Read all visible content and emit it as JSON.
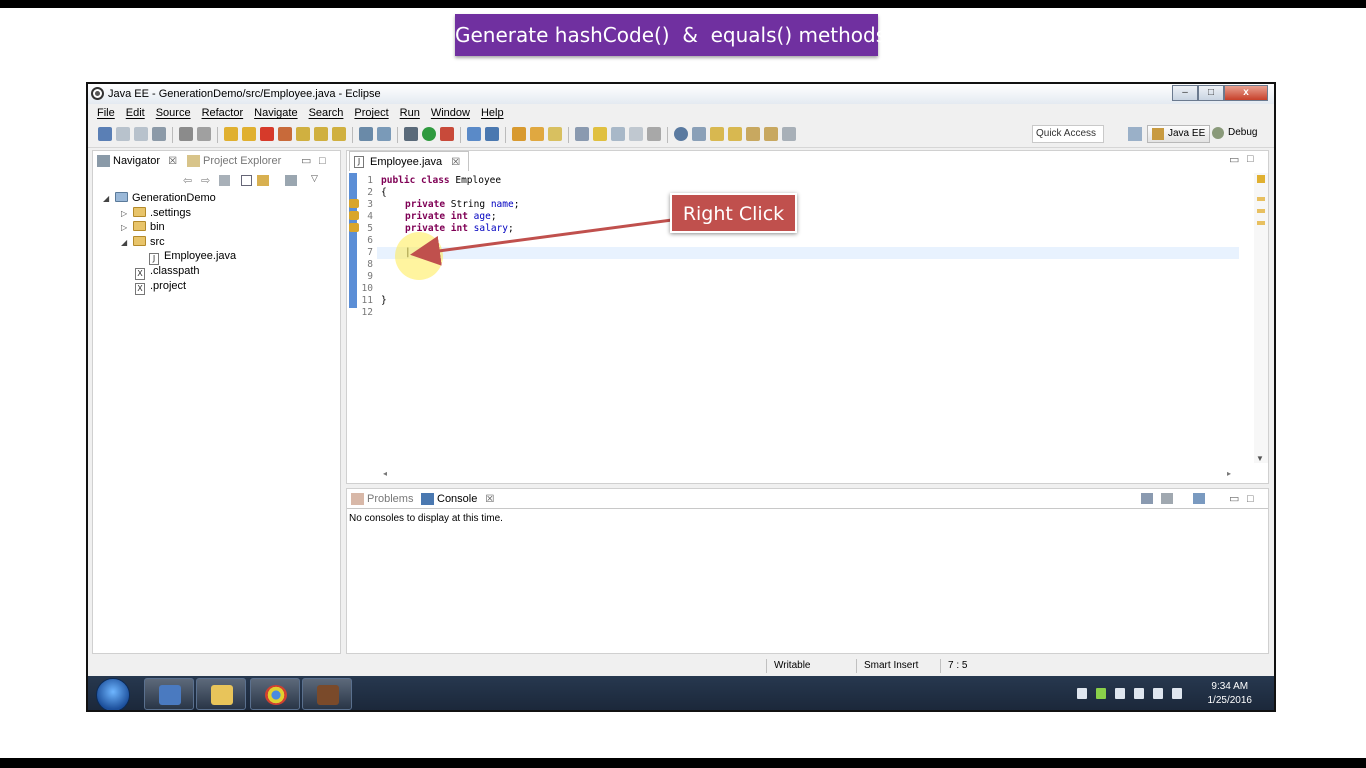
{
  "banner": {
    "text": "Generate hashCode()  &  equals() methods"
  },
  "window": {
    "title": "Java EE - GenerationDemo/src/Employee.java - Eclipse",
    "min": "–",
    "max": "□",
    "close": "x"
  },
  "menu": [
    "File",
    "Edit",
    "Source",
    "Refactor",
    "Navigate",
    "Search",
    "Project",
    "Run",
    "Window",
    "Help"
  ],
  "toolbar": {
    "quick_access": "Quick Access",
    "perspective_active": "Java EE",
    "perspective_other": "Debug"
  },
  "left_panel": {
    "tabs": [
      "Navigator",
      "Project Explorer"
    ],
    "close_glyph": "☒",
    "tree": {
      "project": "GenerationDemo",
      "settings": ".settings",
      "bin": "bin",
      "src": "src",
      "file": "Employee.java",
      "classpath": ".classpath",
      "project_file": ".project"
    }
  },
  "editor": {
    "tab": "Employee.java",
    "close_glyph": "☒",
    "line_numbers": [
      "1",
      "2",
      "3",
      "4",
      "5",
      "6",
      "7",
      "8",
      "9",
      "10",
      "11",
      "12"
    ],
    "lines": {
      "l1_kw": "public class",
      "l1_name": " Employee",
      "l2": "{",
      "l3_kw": "private",
      "l3_type": " String ",
      "l3_field": "name",
      "l4_kw": "private int",
      "l4_field": "age",
      "l5_kw": "private int",
      "l5_field": "salary",
      "semicolon": ";",
      "l7": "|",
      "l11": "}"
    }
  },
  "console": {
    "tabs": [
      "Problems",
      "Console"
    ],
    "close_glyph": "☒",
    "message": "No consoles to display at this time."
  },
  "status": {
    "writable": "Writable",
    "insert": "Smart Insert",
    "position": "7 : 5"
  },
  "taskbar": {
    "time": "9:34 AM",
    "date": "1/25/2016"
  },
  "annotation": {
    "callout": "Right Click"
  },
  "colors": {
    "banner": "#7030a0",
    "callout": "#c0504d",
    "keyword": "#7f0055",
    "field": "#0000c0"
  }
}
